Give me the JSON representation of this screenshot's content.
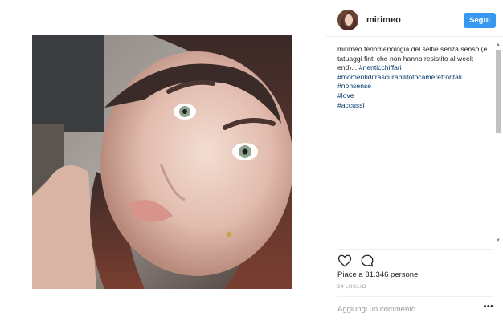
{
  "post": {
    "username": "mirimeo",
    "follow_label": "Segui",
    "caption": {
      "user": "mirimeo",
      "text": " fenomenologia del selfie senza senso (e tatuaggi finti che non hanno resistito al week end)... ",
      "inline_hashtag": "#nenticchiffari",
      "hashtags": [
        "#momentiditrascurabilifotocamerefrontali",
        "#nonsense",
        "#love",
        "#accussì"
      ]
    },
    "likes_prefix": "Piace a ",
    "likes_count": "31.346",
    "likes_suffix": " persone",
    "date": "24 LUGLIO",
    "comment_placeholder": "Aggiungi un commento...",
    "more_label": "•••"
  },
  "icons": {
    "like": "heart-icon",
    "comment": "comment-icon",
    "avatar": "avatar"
  },
  "colors": {
    "follow_button": "#3897f0",
    "hashtag": "#003569",
    "date": "#999999"
  }
}
